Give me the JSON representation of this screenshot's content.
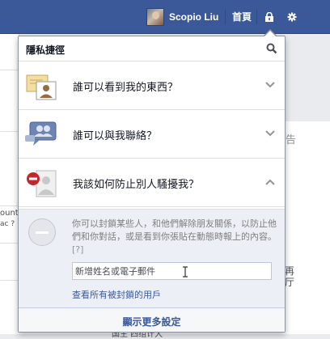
{
  "topbar": {
    "profile_name": "Scopio Liu",
    "home_label": "首頁",
    "accent": "#3b5998"
  },
  "background": {
    "left_fragment_1": "ount",
    "left_fragment_2": "ac ?",
    "right_fragment_1": "告",
    "right_fragment_2": "再",
    "right_fragment_3": "厅",
    "bottom_fragment": "国主   四组计大"
  },
  "privacy": {
    "title": "隱私捷徑",
    "search_icon": "search-icon",
    "rows": [
      {
        "label": "誰可以看到我的東西？",
        "icon": "profile-card-icon",
        "expanded": false
      },
      {
        "label": "誰可以與我聯絡？",
        "icon": "people-chat-icon",
        "expanded": false
      },
      {
        "label": "我該如何防止別人騷擾我？",
        "icon": "block-user-icon",
        "expanded": true
      }
    ],
    "block": {
      "description": "你可以封鎖某些人，和他們解除朋友關係，以防止他們和你對話，或是看到你張貼在動態時報上的內容。",
      "help": "[?]",
      "input_placeholder": "新增姓名或電子郵件",
      "link": "查看所有被封鎖的用戶"
    },
    "footer_label": "顯示更多設定"
  }
}
